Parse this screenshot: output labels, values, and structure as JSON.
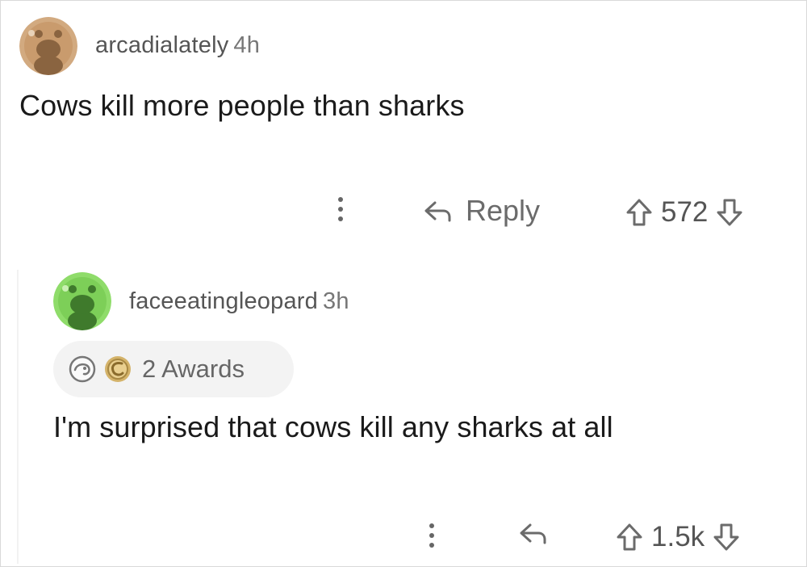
{
  "comments": [
    {
      "username": "arcadialately",
      "age": "4h",
      "text": "Cows kill more people than sharks",
      "reply_label": "Reply",
      "score": "572",
      "avatar_color": "#d2aa80"
    },
    {
      "username": "faceeatingleopard",
      "age": "3h",
      "awards_label": "2 Awards",
      "text": "I'm surprised that cows kill any sharks at all",
      "score": "1.5k",
      "avatar_color": "#8fdc6a"
    }
  ],
  "icons": {
    "menu": "kebab-icon",
    "reply": "reply-arrow-icon",
    "upvote": "upvote-arrow-icon",
    "downvote": "downvote-arrow-icon",
    "award_1": "wholesome-award-icon",
    "award_2": "gold-award-icon"
  },
  "colors": {
    "text_primary": "#1a1a1a",
    "text_meta": "#6b6b6b",
    "awards_pill_bg": "#f3f3f3"
  }
}
